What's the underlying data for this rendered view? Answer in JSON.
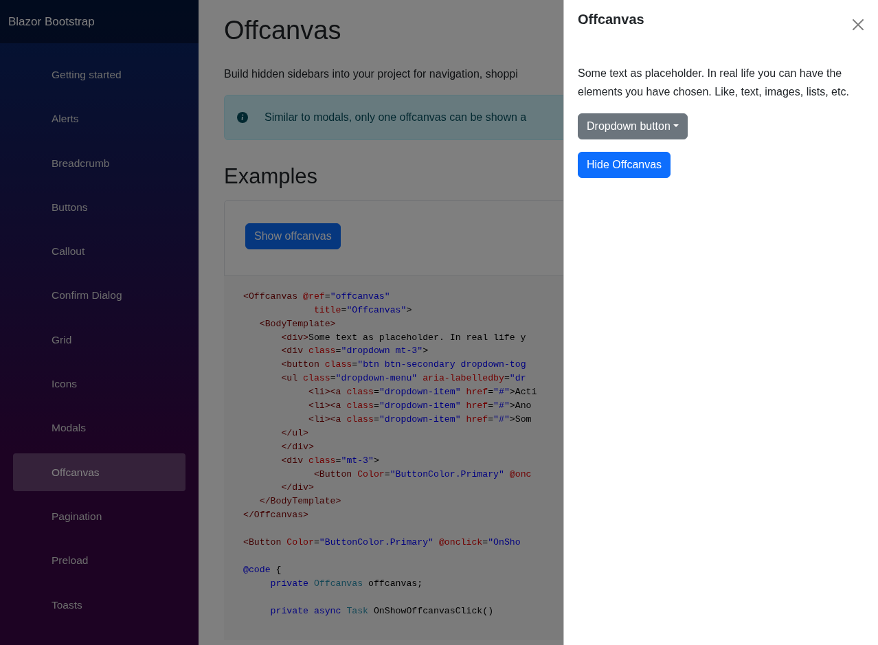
{
  "sidebar": {
    "brand": "Blazor Bootstrap",
    "items": [
      {
        "label": "Getting started",
        "selected": false
      },
      {
        "label": "Alerts",
        "selected": false
      },
      {
        "label": "Breadcrumb",
        "selected": false
      },
      {
        "label": "Buttons",
        "selected": false
      },
      {
        "label": "Callout",
        "selected": false
      },
      {
        "label": "Confirm Dialog",
        "selected": false
      },
      {
        "label": "Grid",
        "selected": false
      },
      {
        "label": "Icons",
        "selected": false
      },
      {
        "label": "Modals",
        "selected": false
      },
      {
        "label": "Offcanvas",
        "selected": true
      },
      {
        "label": "Pagination",
        "selected": false
      },
      {
        "label": "Preload",
        "selected": false
      },
      {
        "label": "Toasts",
        "selected": false
      }
    ]
  },
  "page": {
    "title": "Offcanvas",
    "lead": "Build hidden sidebars into your project for navigation, shoppi",
    "alert": "Similar to modals, only one offcanvas can be shown a",
    "section_title": "Examples",
    "demo_button": "Show offcanvas",
    "code_blocks": [
      [
        [
          {
            "kind": "tag",
            "text": "<Offcanvas "
          },
          {
            "kind": "attr",
            "text": "@ref"
          },
          {
            "kind": "plain",
            "text": "="
          },
          {
            "kind": "value",
            "text": "\"offcanvas\""
          }
        ],
        [
          {
            "kind": "attr",
            "text": "             title"
          },
          {
            "kind": "plain",
            "text": "="
          },
          {
            "kind": "value",
            "text": "\"Offcanvas\""
          },
          {
            "kind": "plain",
            "text": ">"
          }
        ],
        [
          {
            "kind": "tag",
            "text": "   <BodyTemplate>"
          }
        ],
        [
          {
            "kind": "tag",
            "text": "       <div>"
          },
          {
            "kind": "plain",
            "text": "Some text as placeholder. In real life y"
          }
        ],
        [
          {
            "kind": "tag",
            "text": "       <div "
          },
          {
            "kind": "attr",
            "text": "class"
          },
          {
            "kind": "plain",
            "text": "="
          },
          {
            "kind": "value",
            "text": "\"dropdown mt-3\""
          },
          {
            "kind": "plain",
            "text": ">"
          }
        ],
        [
          {
            "kind": "tag",
            "text": "       <button "
          },
          {
            "kind": "attr",
            "text": "class"
          },
          {
            "kind": "plain",
            "text": "="
          },
          {
            "kind": "value",
            "text": "\"btn btn-secondary dropdown-tog"
          }
        ],
        [
          {
            "kind": "tag",
            "text": "       <ul "
          },
          {
            "kind": "attr",
            "text": "class"
          },
          {
            "kind": "plain",
            "text": "="
          },
          {
            "kind": "value",
            "text": "\"dropdown-menu\" "
          },
          {
            "kind": "attr",
            "text": "aria-labelledby"
          },
          {
            "kind": "plain",
            "text": "="
          },
          {
            "kind": "value",
            "text": "\"dr"
          }
        ],
        [
          {
            "kind": "tag",
            "text": "            <li><a "
          },
          {
            "kind": "attr",
            "text": "class"
          },
          {
            "kind": "plain",
            "text": "="
          },
          {
            "kind": "value",
            "text": "\"dropdown-item\" "
          },
          {
            "kind": "attr",
            "text": "href"
          },
          {
            "kind": "plain",
            "text": "="
          },
          {
            "kind": "value",
            "text": "\"#\""
          },
          {
            "kind": "plain",
            "text": ">Acti"
          }
        ],
        [
          {
            "kind": "tag",
            "text": "            <li><a "
          },
          {
            "kind": "attr",
            "text": "class"
          },
          {
            "kind": "plain",
            "text": "="
          },
          {
            "kind": "value",
            "text": "\"dropdown-item\" "
          },
          {
            "kind": "attr",
            "text": "href"
          },
          {
            "kind": "plain",
            "text": "="
          },
          {
            "kind": "value",
            "text": "\"#\""
          },
          {
            "kind": "plain",
            "text": ">Ano"
          }
        ],
        [
          {
            "kind": "tag",
            "text": "            <li><a "
          },
          {
            "kind": "attr",
            "text": "class"
          },
          {
            "kind": "plain",
            "text": "="
          },
          {
            "kind": "value",
            "text": "\"dropdown-item\" "
          },
          {
            "kind": "attr",
            "text": "href"
          },
          {
            "kind": "plain",
            "text": "="
          },
          {
            "kind": "value",
            "text": "\"#\""
          },
          {
            "kind": "plain",
            "text": ">Som"
          }
        ],
        [
          {
            "kind": "tag",
            "text": "       </ul>"
          }
        ],
        [
          {
            "kind": "tag",
            "text": "       </div>"
          }
        ],
        [
          {
            "kind": "tag",
            "text": "       <div "
          },
          {
            "kind": "attr",
            "text": "class"
          },
          {
            "kind": "plain",
            "text": "="
          },
          {
            "kind": "value",
            "text": "\"mt-3\""
          },
          {
            "kind": "plain",
            "text": ">"
          }
        ],
        [
          {
            "kind": "tag",
            "text": "             <Button "
          },
          {
            "kind": "attr",
            "text": "Color"
          },
          {
            "kind": "plain",
            "text": "="
          },
          {
            "kind": "value",
            "text": "\"ButtonColor.Primary\" "
          },
          {
            "kind": "attr",
            "text": "@onc"
          }
        ],
        [
          {
            "kind": "tag",
            "text": "       </div>"
          }
        ],
        [
          {
            "kind": "tag",
            "text": "   </BodyTemplate>"
          }
        ],
        [
          {
            "kind": "tag",
            "text": "</Offcanvas>"
          }
        ]
      ],
      [
        [
          {
            "kind": "tag",
            "text": "<Button "
          },
          {
            "kind": "attr",
            "text": "Color"
          },
          {
            "kind": "plain",
            "text": "="
          },
          {
            "kind": "value",
            "text": "\"ButtonColor.Primary\" "
          },
          {
            "kind": "attr",
            "text": "@onclick"
          },
          {
            "kind": "plain",
            "text": "="
          },
          {
            "kind": "value",
            "text": "\"OnSho"
          }
        ]
      ],
      [
        [
          {
            "kind": "keyword",
            "text": "@code"
          },
          {
            "kind": "plain",
            "text": " {"
          }
        ],
        [
          {
            "kind": "keyword",
            "text": "     private "
          },
          {
            "kind": "type",
            "text": "Offcanvas"
          },
          {
            "kind": "plain",
            "text": " offcanvas;"
          }
        ]
      ],
      [
        [
          {
            "kind": "keyword",
            "text": "     private async "
          },
          {
            "kind": "type",
            "text": "Task"
          },
          {
            "kind": "plain",
            "text": " OnShowOffcanvasClick()"
          }
        ]
      ]
    ]
  },
  "offcanvas": {
    "title": "Offcanvas",
    "body": "Some text as placeholder. In real life you can have the elements you have chosen. Like, text, images, lists, etc.",
    "dropdown_button": "Dropdown button",
    "hide_button": "Hide Offcanvas"
  }
}
